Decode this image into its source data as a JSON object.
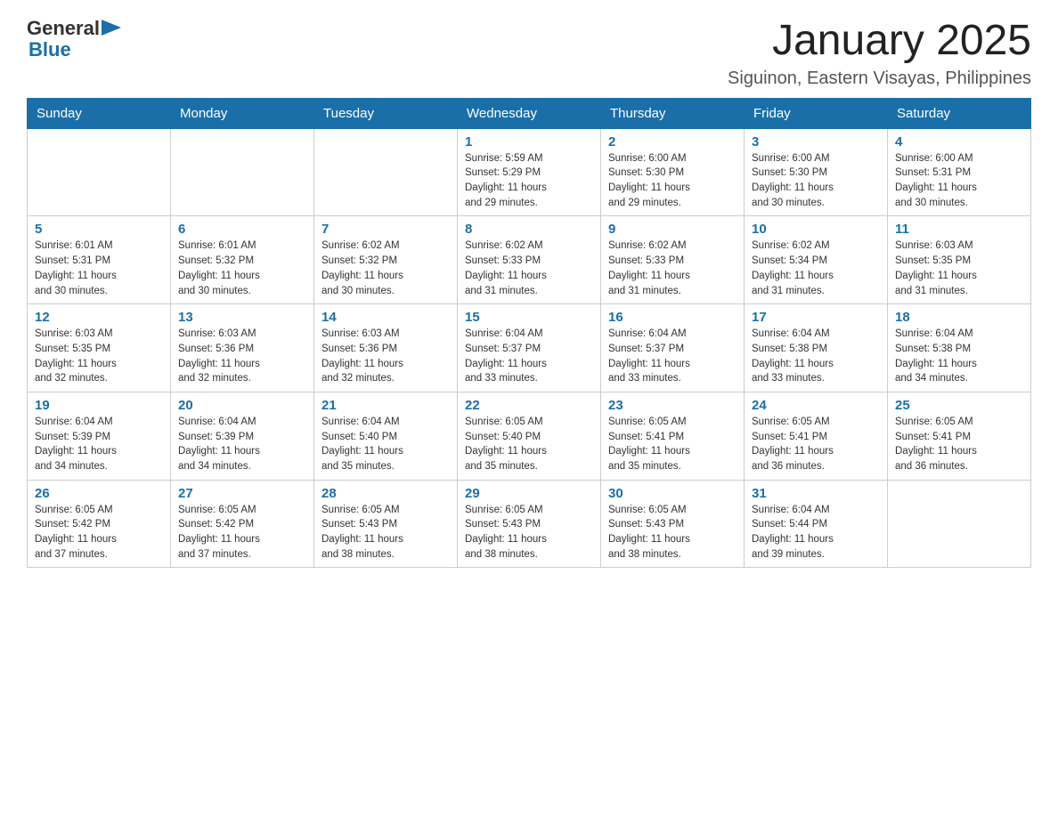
{
  "header": {
    "logo_general": "General",
    "logo_blue": "Blue",
    "month_title": "January 2025",
    "location": "Siguinon, Eastern Visayas, Philippines"
  },
  "weekdays": [
    "Sunday",
    "Monday",
    "Tuesday",
    "Wednesday",
    "Thursday",
    "Friday",
    "Saturday"
  ],
  "weeks": [
    [
      {
        "day": "",
        "info": ""
      },
      {
        "day": "",
        "info": ""
      },
      {
        "day": "",
        "info": ""
      },
      {
        "day": "1",
        "info": "Sunrise: 5:59 AM\nSunset: 5:29 PM\nDaylight: 11 hours\nand 29 minutes."
      },
      {
        "day": "2",
        "info": "Sunrise: 6:00 AM\nSunset: 5:30 PM\nDaylight: 11 hours\nand 29 minutes."
      },
      {
        "day": "3",
        "info": "Sunrise: 6:00 AM\nSunset: 5:30 PM\nDaylight: 11 hours\nand 30 minutes."
      },
      {
        "day": "4",
        "info": "Sunrise: 6:00 AM\nSunset: 5:31 PM\nDaylight: 11 hours\nand 30 minutes."
      }
    ],
    [
      {
        "day": "5",
        "info": "Sunrise: 6:01 AM\nSunset: 5:31 PM\nDaylight: 11 hours\nand 30 minutes."
      },
      {
        "day": "6",
        "info": "Sunrise: 6:01 AM\nSunset: 5:32 PM\nDaylight: 11 hours\nand 30 minutes."
      },
      {
        "day": "7",
        "info": "Sunrise: 6:02 AM\nSunset: 5:32 PM\nDaylight: 11 hours\nand 30 minutes."
      },
      {
        "day": "8",
        "info": "Sunrise: 6:02 AM\nSunset: 5:33 PM\nDaylight: 11 hours\nand 31 minutes."
      },
      {
        "day": "9",
        "info": "Sunrise: 6:02 AM\nSunset: 5:33 PM\nDaylight: 11 hours\nand 31 minutes."
      },
      {
        "day": "10",
        "info": "Sunrise: 6:02 AM\nSunset: 5:34 PM\nDaylight: 11 hours\nand 31 minutes."
      },
      {
        "day": "11",
        "info": "Sunrise: 6:03 AM\nSunset: 5:35 PM\nDaylight: 11 hours\nand 31 minutes."
      }
    ],
    [
      {
        "day": "12",
        "info": "Sunrise: 6:03 AM\nSunset: 5:35 PM\nDaylight: 11 hours\nand 32 minutes."
      },
      {
        "day": "13",
        "info": "Sunrise: 6:03 AM\nSunset: 5:36 PM\nDaylight: 11 hours\nand 32 minutes."
      },
      {
        "day": "14",
        "info": "Sunrise: 6:03 AM\nSunset: 5:36 PM\nDaylight: 11 hours\nand 32 minutes."
      },
      {
        "day": "15",
        "info": "Sunrise: 6:04 AM\nSunset: 5:37 PM\nDaylight: 11 hours\nand 33 minutes."
      },
      {
        "day": "16",
        "info": "Sunrise: 6:04 AM\nSunset: 5:37 PM\nDaylight: 11 hours\nand 33 minutes."
      },
      {
        "day": "17",
        "info": "Sunrise: 6:04 AM\nSunset: 5:38 PM\nDaylight: 11 hours\nand 33 minutes."
      },
      {
        "day": "18",
        "info": "Sunrise: 6:04 AM\nSunset: 5:38 PM\nDaylight: 11 hours\nand 34 minutes."
      }
    ],
    [
      {
        "day": "19",
        "info": "Sunrise: 6:04 AM\nSunset: 5:39 PM\nDaylight: 11 hours\nand 34 minutes."
      },
      {
        "day": "20",
        "info": "Sunrise: 6:04 AM\nSunset: 5:39 PM\nDaylight: 11 hours\nand 34 minutes."
      },
      {
        "day": "21",
        "info": "Sunrise: 6:04 AM\nSunset: 5:40 PM\nDaylight: 11 hours\nand 35 minutes."
      },
      {
        "day": "22",
        "info": "Sunrise: 6:05 AM\nSunset: 5:40 PM\nDaylight: 11 hours\nand 35 minutes."
      },
      {
        "day": "23",
        "info": "Sunrise: 6:05 AM\nSunset: 5:41 PM\nDaylight: 11 hours\nand 35 minutes."
      },
      {
        "day": "24",
        "info": "Sunrise: 6:05 AM\nSunset: 5:41 PM\nDaylight: 11 hours\nand 36 minutes."
      },
      {
        "day": "25",
        "info": "Sunrise: 6:05 AM\nSunset: 5:41 PM\nDaylight: 11 hours\nand 36 minutes."
      }
    ],
    [
      {
        "day": "26",
        "info": "Sunrise: 6:05 AM\nSunset: 5:42 PM\nDaylight: 11 hours\nand 37 minutes."
      },
      {
        "day": "27",
        "info": "Sunrise: 6:05 AM\nSunset: 5:42 PM\nDaylight: 11 hours\nand 37 minutes."
      },
      {
        "day": "28",
        "info": "Sunrise: 6:05 AM\nSunset: 5:43 PM\nDaylight: 11 hours\nand 38 minutes."
      },
      {
        "day": "29",
        "info": "Sunrise: 6:05 AM\nSunset: 5:43 PM\nDaylight: 11 hours\nand 38 minutes."
      },
      {
        "day": "30",
        "info": "Sunrise: 6:05 AM\nSunset: 5:43 PM\nDaylight: 11 hours\nand 38 minutes."
      },
      {
        "day": "31",
        "info": "Sunrise: 6:04 AM\nSunset: 5:44 PM\nDaylight: 11 hours\nand 39 minutes."
      },
      {
        "day": "",
        "info": ""
      }
    ]
  ]
}
